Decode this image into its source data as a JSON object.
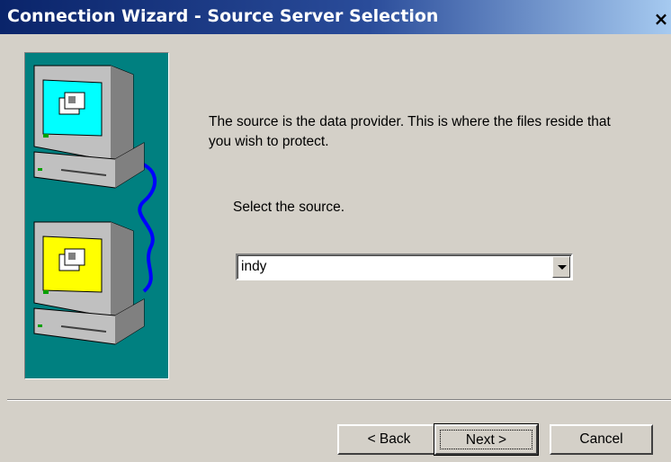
{
  "window": {
    "title": "Connection Wizard - Source Server Selection",
    "close_glyph": "×"
  },
  "content": {
    "description": "The source is the data provider. This is where the files reside that you wish to protect.",
    "select_label": "Select the source.",
    "source_value": "indy"
  },
  "buttons": {
    "back": "< Back",
    "next": "Next >",
    "cancel": "Cancel"
  },
  "icons": [
    "computer-icon",
    "folder-icon",
    "network-cable-icon",
    "chevron-down-icon",
    "close-icon"
  ],
  "colors": {
    "titlebar_start": "#0a246a",
    "titlebar_end": "#a6caf0",
    "dialog_bg": "#d4d0c8",
    "art_bg": "#008080",
    "top_screen": "#00ffff",
    "bottom_screen": "#ffff00",
    "cable": "#0000ff"
  }
}
